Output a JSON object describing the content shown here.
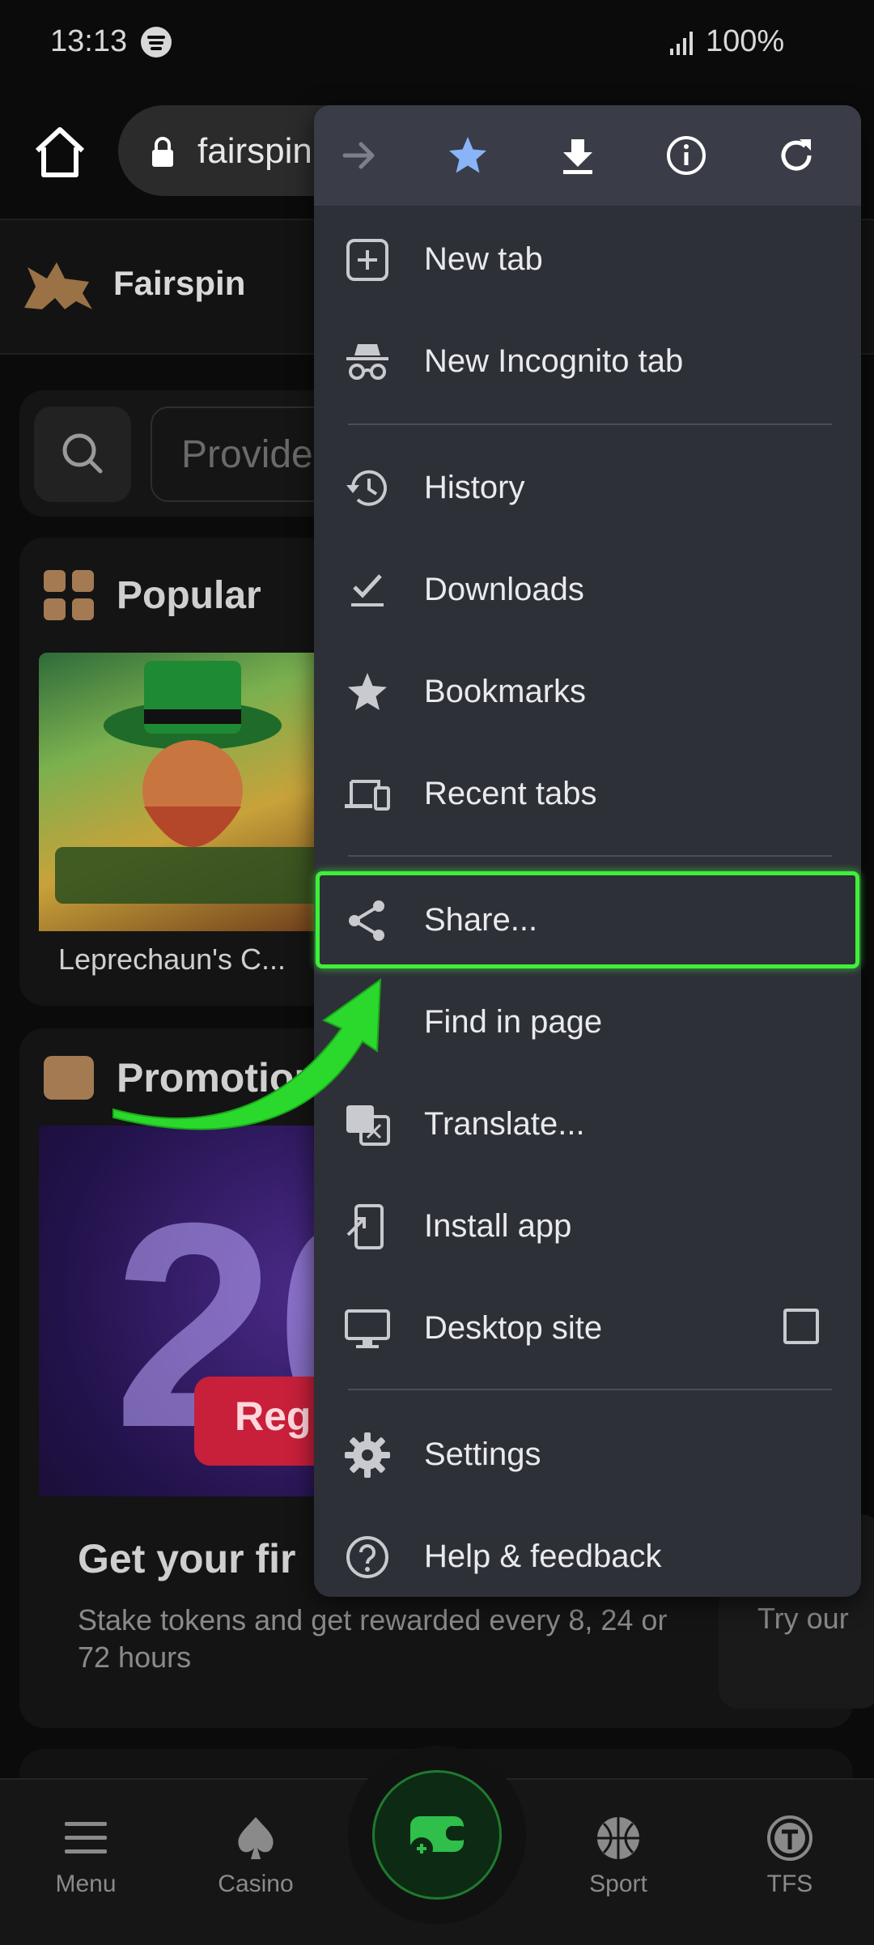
{
  "status_bar": {
    "time": "13:13",
    "battery": "100%"
  },
  "browser": {
    "url": "fairspin"
  },
  "site": {
    "brand": "Fairspin",
    "search_placeholder": "Provide",
    "popular": {
      "title": "Popular",
      "game_caption": "Leprechaun's C..."
    },
    "promotions": {
      "title": "Promotion",
      "banner_digit": "20",
      "banner_button": "Regi",
      "heading": "Get your fir",
      "description": "Stake tokens and get rewarded every 8, 24 or 72 hours",
      "side_text": "Try our"
    }
  },
  "bottom_nav": {
    "items": [
      "Menu",
      "Casino",
      "Sport",
      "TFS"
    ]
  },
  "menu": {
    "items": [
      "New tab",
      "New Incognito tab",
      "History",
      "Downloads",
      "Bookmarks",
      "Recent tabs",
      "Share...",
      "Find in page",
      "Translate...",
      "Install app",
      "Desktop site",
      "Settings",
      "Help & feedback"
    ],
    "highlighted_item": "Share...",
    "highlight_color": "#3df03a"
  }
}
